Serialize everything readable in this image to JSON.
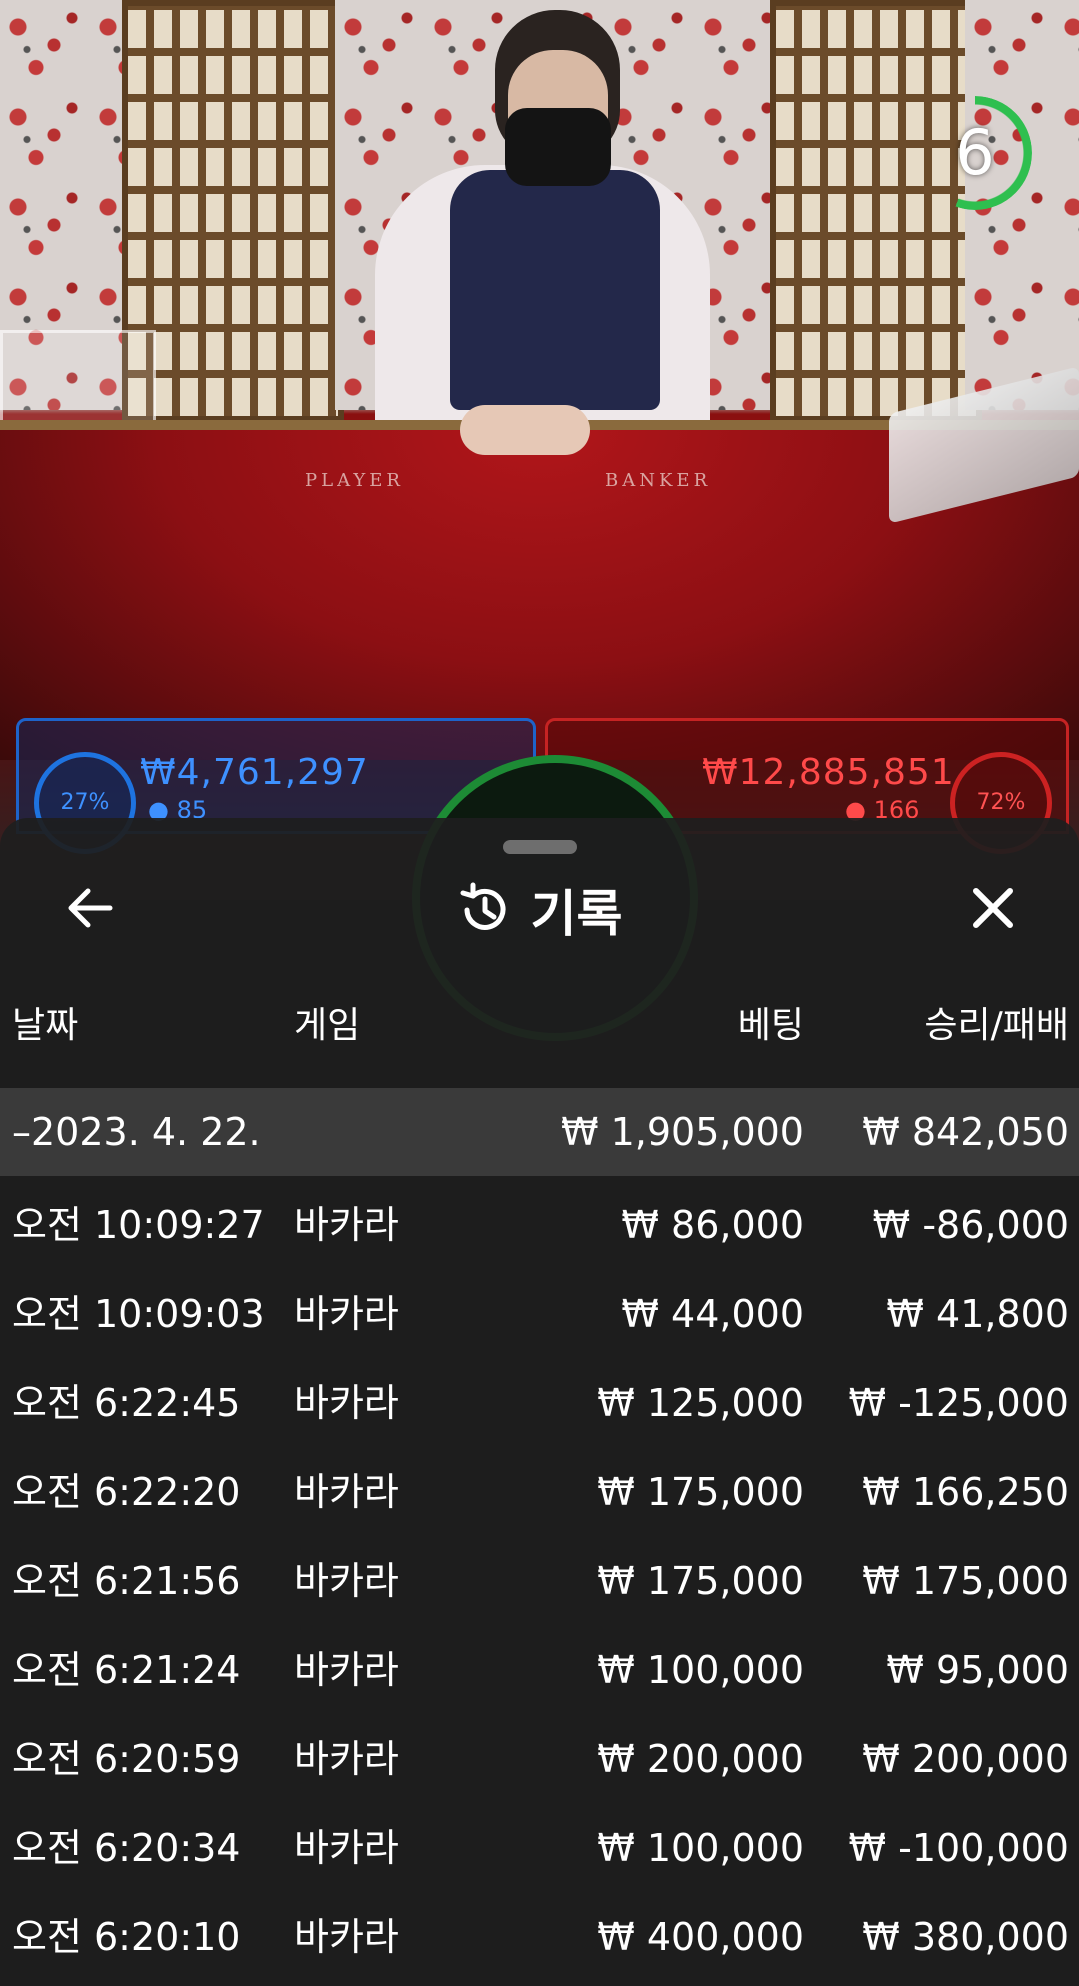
{
  "live": {
    "felt_left": "PLAYER",
    "felt_right": "BANKER",
    "timer": "6",
    "player": {
      "percent": "27%",
      "amount": "₩4,761,297",
      "count": "85"
    },
    "banker": {
      "percent": "72%",
      "amount": "₩12,885,851",
      "count": "166"
    }
  },
  "history": {
    "title": "기록",
    "icons": {
      "back": "arrow-left-icon",
      "history": "history-icon",
      "close": "close-icon"
    },
    "columns": {
      "date": "날짜",
      "game": "게임",
      "bet": "베팅",
      "result": "승리/패배"
    },
    "date_group": {
      "date": "–2023. 4. 22.",
      "bet_total": "₩ 1,905,000",
      "result_total": "₩ 842,050"
    },
    "rows": [
      {
        "time": "오전 10:09:27",
        "game": "바카라",
        "bet": "₩ 86,000",
        "result": "₩ -86,000"
      },
      {
        "time": "오전 10:09:03",
        "game": "바카라",
        "bet": "₩ 44,000",
        "result": "₩ 41,800"
      },
      {
        "time": "오전 6:22:45",
        "game": "바카라",
        "bet": "₩ 125,000",
        "result": "₩ -125,000"
      },
      {
        "time": "오전 6:22:20",
        "game": "바카라",
        "bet": "₩ 175,000",
        "result": "₩ 166,250"
      },
      {
        "time": "오전 6:21:56",
        "game": "바카라",
        "bet": "₩ 175,000",
        "result": "₩ 175,000"
      },
      {
        "time": "오전 6:21:24",
        "game": "바카라",
        "bet": "₩ 100,000",
        "result": "₩ 95,000"
      },
      {
        "time": "오전 6:20:59",
        "game": "바카라",
        "bet": "₩ 200,000",
        "result": "₩ 200,000"
      },
      {
        "time": "오전 6:20:34",
        "game": "바카라",
        "bet": "₩ 100,000",
        "result": "₩ -100,000"
      },
      {
        "time": "오전 6:20:10",
        "game": "바카라",
        "bet": "₩ 400,000",
        "result": "₩ 380,000"
      }
    ]
  }
}
